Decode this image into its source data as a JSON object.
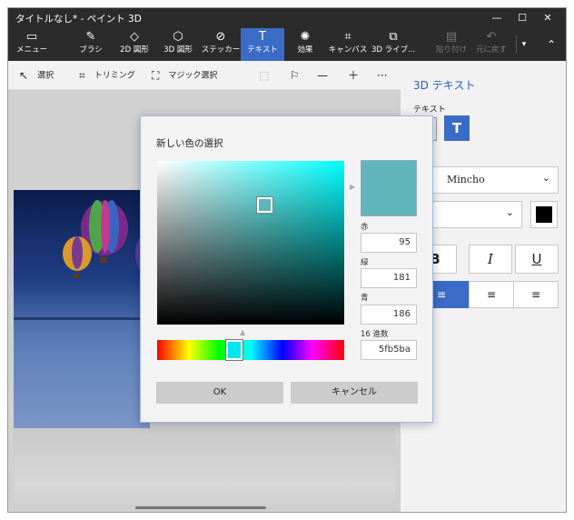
{
  "window": {
    "title": "タイトルなし* - ペイント 3D",
    "accent_color": "#3a6cc7"
  },
  "ribbon": {
    "menu": "メニュー",
    "brush": "ブラシ",
    "shapes2d": "2D 図形",
    "shapes3d": "3D 図形",
    "stickers": "ステッカー",
    "text": "テキスト",
    "effects": "効果",
    "canvas": "キャンバス",
    "library3d": "3D ライブ...",
    "paste": "貼り付け",
    "undo": "元に戻す"
  },
  "toolbar2": {
    "select": "選択",
    "crop": "トリミング",
    "magic_select": "マジック選択"
  },
  "panel": {
    "title": "3D テキスト",
    "text_label": "テキスト",
    "font_name": "Mincho",
    "bold": "B",
    "italic": "I",
    "underline": "U",
    "text_color": "#000000"
  },
  "dialog": {
    "title": "新しい色の選択",
    "red_label": "赤",
    "red_value": "95",
    "green_label": "緑",
    "green_value": "181",
    "blue_label": "青",
    "blue_value": "186",
    "hex_label": "16 進数",
    "hex_value": "5fb5ba",
    "ok": "OK",
    "cancel": "キャンセル",
    "preview_color": "#5fb5ba"
  }
}
